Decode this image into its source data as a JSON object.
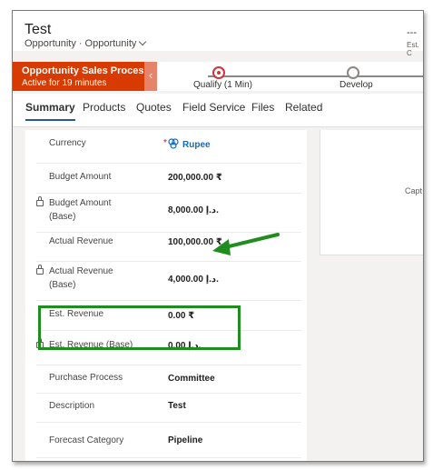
{
  "header": {
    "title": "Test",
    "entity": "Opportunity",
    "separator": "·",
    "form_name": "Opportunity",
    "right_top": "---",
    "right_bottom": "Est. C"
  },
  "bpf": {
    "process_name": "Opportunity Sales Process",
    "active_for": "Active for 19 minutes",
    "back": "‹",
    "stages": [
      {
        "label": "Qualify  (1 Min)",
        "state": "active"
      },
      {
        "label": "Develop",
        "state": "inactive"
      }
    ]
  },
  "tabs": [
    {
      "label": "Summary",
      "active": true
    },
    {
      "label": "Products"
    },
    {
      "label": "Quotes"
    },
    {
      "label": "Field Service"
    },
    {
      "label": "Files"
    },
    {
      "label": "Related"
    }
  ],
  "fields": {
    "currency": {
      "label": "Currency",
      "required": "*",
      "value": "Rupee"
    },
    "budget_amount": {
      "label": "Budget Amount",
      "value": "200,000.00 ₹"
    },
    "budget_amount_base": {
      "label1": "Budget Amount",
      "label2": "(Base)",
      "value": "8,000.00 د.إ."
    },
    "actual_revenue": {
      "label": "Actual Revenue",
      "value": "100,000.00 ₹"
    },
    "actual_revenue_base": {
      "label1": "Actual Revenue",
      "label2": "(Base)",
      "value": "4,000.00 د.إ."
    },
    "est_revenue": {
      "label": "Est. Revenue",
      "value": "0.00 ₹"
    },
    "est_revenue_base": {
      "label": "Est. Revenue (Base)",
      "value": "0.00 د.إ."
    },
    "purchase_process": {
      "label": "Purchase Process",
      "value": "Committee"
    },
    "description": {
      "label": "Description",
      "value": "Test"
    },
    "forecast_category": {
      "label": "Forecast Category",
      "value": "Pipeline"
    }
  },
  "right_panel": {
    "text": "Capt"
  },
  "colors": {
    "stage_active": "#d83b01",
    "highlight": "#1f8e1f",
    "link": "#0f6cbd",
    "tab_underline": "#2b579a"
  }
}
